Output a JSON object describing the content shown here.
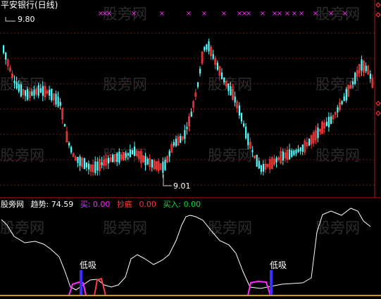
{
  "title": "平安银行(日线)",
  "watermark": "股旁网",
  "price_panel": {
    "high_label": "9.80",
    "low_label": "9.01",
    "up_color": "#ff3b3b",
    "down_color": "#54ffff",
    "signal_marker": "×",
    "signal_color": "#ff2cff"
  },
  "indicator_panel": {
    "brand": "股旁网",
    "trend_label": "趋势:",
    "trend_value": "74.59",
    "buy_label": "买:",
    "buy_value": "0.00",
    "bottom_label": "抄底",
    "bottom_value": "0.00",
    "buyin_label": "买入:",
    "buyin_value": "0.00",
    "low_suction_label": "低吸",
    "low_suction_label_2": "低吸",
    "trend_color": "#ffffff",
    "buy_color": "#ff2cff",
    "bottom_color": "#ff3b3b",
    "buyin_color": "#00e040"
  }
}
